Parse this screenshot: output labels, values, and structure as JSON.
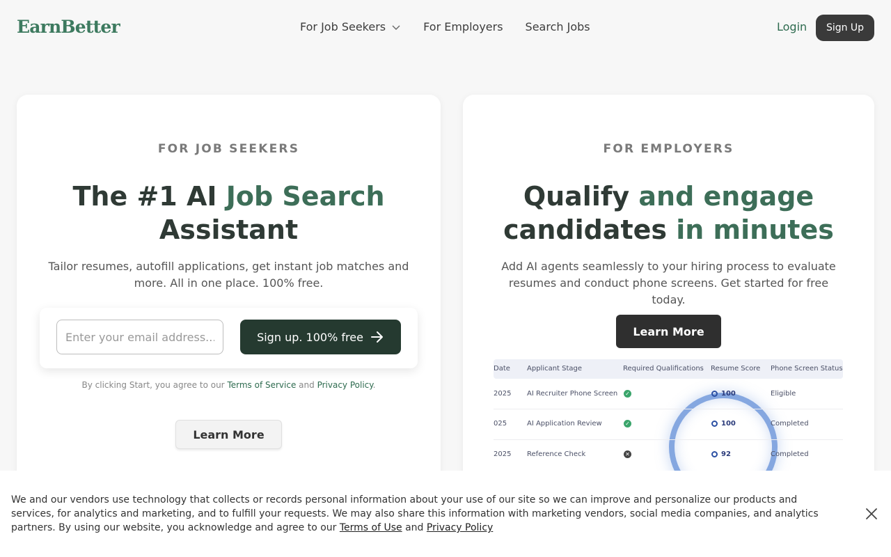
{
  "header": {
    "logo": "EarnBetter",
    "nav": [
      {
        "label": "For Job Seekers",
        "has_dropdown": true
      },
      {
        "label": "For Employers"
      },
      {
        "label": "Search Jobs"
      }
    ],
    "login": "Login",
    "signup": "Sign Up"
  },
  "seekers": {
    "eyebrow": "FOR JOB SEEKERS",
    "headline_part1": "The #1 AI",
    "headline_accent": "Job Search",
    "headline_part2": "Assistant",
    "subtitle": "Tailor resumes, autofill applications, get instant job matches and more. All in one place. 100% free.",
    "email_placeholder": "Enter your email address...",
    "cta": "Sign up. 100% free",
    "terms_prefix": "By clicking Start, you agree to our",
    "terms_link": "Terms of Service",
    "terms_and": "and",
    "privacy_link": "Privacy Policy",
    "terms_suffix": ".",
    "learn_more": "Learn More"
  },
  "employers": {
    "eyebrow": "FOR EMPLOYERS",
    "headline_part1": "Qualify",
    "headline_accent1": "and engage",
    "headline_part2": "candidates",
    "headline_accent2": "in minutes",
    "subtitle": "Add AI agents seamlessly to your hiring process to evaluate resumes and conduct phone screens. Get started for free today.",
    "learn_more": "Learn More",
    "table": {
      "headers": [
        "Date",
        "Applicant Stage",
        "Required Qualifications",
        "Resume Score",
        "Phone Screen Status"
      ],
      "rows": [
        {
          "date": "2025",
          "stage": "AI Recruiter Phone Screen",
          "qualified": true,
          "score": "100",
          "status": "Eligible"
        },
        {
          "date": "025",
          "stage": "AI Application Review",
          "qualified": true,
          "score": "100",
          "status": "Completed"
        },
        {
          "date": "2025",
          "stage": "Reference Check",
          "qualified": false,
          "score": "92",
          "status": "Completed"
        }
      ]
    }
  },
  "cookie": {
    "text": "We and our vendors use technology that collects or records personal information about your use of our site so we can improve and personalize our products and services, for analytics and marketing, and to fulfill your requests. We may also share this information with marketing vendors, social media companies, and analytics partners. By using our website, you acknowledge and agree to our",
    "terms_link": "Terms of Use",
    "and": "and",
    "privacy_link": "Privacy Policy"
  },
  "colors": {
    "brand_green": "#3d7a5f",
    "dark_green": "#253a30",
    "accent_text": "#3d6e58"
  },
  "icons": [
    "chevron-down-icon",
    "arrow-right-icon",
    "check-icon",
    "x-icon",
    "close-icon"
  ]
}
